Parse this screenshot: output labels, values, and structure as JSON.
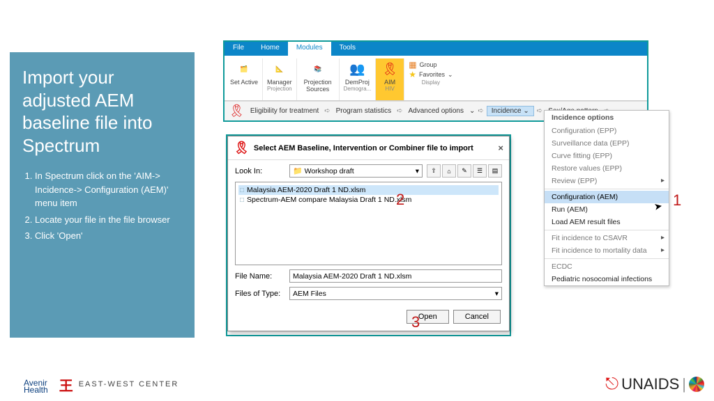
{
  "slide": {
    "title": "Import your adjusted AEM baseline file into Spectrum",
    "steps": [
      "In Spectrum click on the 'AIM-> Incidence-> Configuration (AEM)' menu item",
      "Locate your file in the file browser",
      "Click 'Open'"
    ]
  },
  "ribbon": {
    "tabs": [
      "File",
      "Home",
      "Modules",
      "Tools"
    ],
    "active_tab": "Modules",
    "items": [
      {
        "label": "Set Active",
        "group": ""
      },
      {
        "label": "Manager",
        "group": "Projection"
      },
      {
        "label": "Projection Sources",
        "group": ""
      },
      {
        "label": "DemProj",
        "group": "Demogra..."
      },
      {
        "label": "AIM",
        "group": "HIV"
      },
      {
        "label_group": "Group",
        "label_fav": "Favorites",
        "group": "Display"
      }
    ],
    "bar": {
      "eligibility": "Eligibility for treatment",
      "program": "Program statistics",
      "advanced": "Advanced options",
      "incidence": "Incidence",
      "sexage": "Sex/Age pattern"
    }
  },
  "dropdown": {
    "title": "Incidence options",
    "items": [
      {
        "label": "Configuration (EPP)",
        "enabled": false
      },
      {
        "label": "Surveillance data (EPP)",
        "enabled": false
      },
      {
        "label": "Curve fitting (EPP)",
        "enabled": false
      },
      {
        "label": "Restore values (EPP)",
        "enabled": false
      },
      {
        "label": "Review (EPP)",
        "enabled": false,
        "submenu": true
      },
      {
        "label": "Configuration (AEM)",
        "enabled": true,
        "selected": true
      },
      {
        "label": "Run (AEM)",
        "enabled": true
      },
      {
        "label": "Load AEM result files",
        "enabled": true
      },
      {
        "label": "Fit incidence to CSAVR",
        "enabled": false,
        "submenu": true
      },
      {
        "label": "Fit incidence to mortality data",
        "enabled": false,
        "submenu": true
      },
      {
        "label": "ECDC",
        "enabled": false
      },
      {
        "label": "Pediatric nosocomial infections",
        "enabled": true
      }
    ]
  },
  "dialog": {
    "title": "Select AEM Baseline, Intervention or Combiner file to import",
    "lookin_label": "Look In:",
    "lookin_value": "Workshop draft",
    "files": [
      "Malaysia AEM-2020 Draft 1 ND.xlsm",
      "Spectrum-AEM compare Malaysia Draft 1 ND.xlsm"
    ],
    "filename_label": "File Name:",
    "filename_value": "Malaysia AEM-2020 Draft 1 ND.xlsm",
    "filetype_label": "Files of Type:",
    "filetype_value": "AEM Files",
    "open": "Open",
    "cancel": "Cancel"
  },
  "annotations": {
    "a1": "1",
    "a2": "2",
    "a3": "3"
  },
  "footer": {
    "avenir": "Avenir",
    "avenir_sub": "Health",
    "ewc": "EAST-WEST CENTER",
    "unaids": "UNAIDS"
  }
}
